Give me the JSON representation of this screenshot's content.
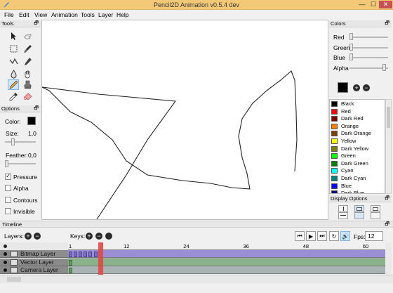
{
  "window": {
    "title": "Pencil2D Animation v0.5.4 dev",
    "min": "—",
    "max": "☐",
    "close": "✕"
  },
  "menu": [
    "File",
    "Edit",
    "View",
    "Animation",
    "Tools",
    "Layer",
    "Help"
  ],
  "tools_panel": {
    "title": "Tools",
    "undock": "🗗"
  },
  "options_panel": {
    "title": "Options",
    "color_label": "Color:",
    "size_label": "Size:",
    "size_value": "1,0",
    "feather_label": "Feather:",
    "feather_value": "0,0",
    "pressure_label": "Pressure",
    "alpha_label": "Alpha",
    "contours_label": "Contours",
    "invisible_label": "Invisible",
    "pressure_checked": true
  },
  "colors_panel": {
    "title": "Colors",
    "red_label": "Red",
    "green_label": "Green",
    "blue_label": "Blue",
    "alpha_label": "Alpha",
    "add_symbol": "+",
    "remove_symbol": "−",
    "swatches": [
      {
        "name": "Black",
        "color": "#000000"
      },
      {
        "name": "Red",
        "color": "#ff0000"
      },
      {
        "name": "Dark Red",
        "color": "#800000"
      },
      {
        "name": "Orange",
        "color": "#ff8000"
      },
      {
        "name": "Dark Orange",
        "color": "#804000"
      },
      {
        "name": "Yellow",
        "color": "#ffff00"
      },
      {
        "name": "Dark Yellow",
        "color": "#808000"
      },
      {
        "name": "Green",
        "color": "#00ff00"
      },
      {
        "name": "Dark Green",
        "color": "#008000"
      },
      {
        "name": "Cyan",
        "color": "#00ffff"
      },
      {
        "name": "Dark Cyan",
        "color": "#008080"
      },
      {
        "name": "Blue",
        "color": "#0000ff"
      },
      {
        "name": "Dark Blue",
        "color": "#000080"
      }
    ]
  },
  "display_options": {
    "title": "Display Options"
  },
  "timeline": {
    "title": "Timeline",
    "layers_label": "Layers:",
    "keys_label": "Keys:",
    "fps_label": "Fps:",
    "fps_value": "12",
    "ruler": [
      "1",
      "12",
      "24",
      "36",
      "48",
      "60"
    ],
    "layers": [
      {
        "name": "Bitmap Layer",
        "selected": true
      },
      {
        "name": "Vector Layer",
        "selected": false
      },
      {
        "name": "Camera Layer",
        "selected": false
      }
    ],
    "current_frame": 7
  },
  "colors": {
    "selected_tool_bg": "#cde4f7",
    "playhead": "#e04848",
    "bitmap_frames": "#9a8fd4",
    "vector_frames": "#8bb38b",
    "camera_frames": "#a8b4b4"
  }
}
